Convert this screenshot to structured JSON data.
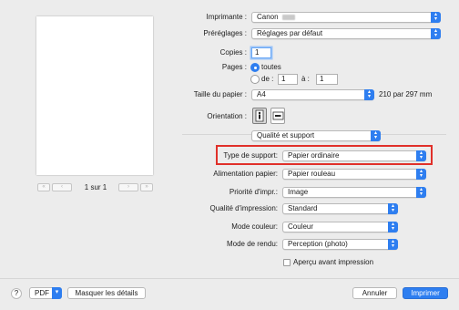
{
  "preview": {
    "page_indicator": "1 sur 1",
    "nav_first": "«",
    "nav_prev": "‹",
    "nav_next": "›",
    "nav_last": "»"
  },
  "form": {
    "printer_label": "Imprimante :",
    "printer_value": "Canon",
    "presets_label": "Préréglages :",
    "presets_value": "Réglages par défaut",
    "copies_label": "Copies :",
    "copies_value": "1",
    "pages_label": "Pages :",
    "pages_all": "toutes",
    "pages_from": "de :",
    "pages_from_value": "1",
    "pages_to": "à :",
    "pages_to_value": "1",
    "paper_size_label": "Taille du papier :",
    "paper_size_value": "A4",
    "paper_size_dims": "210 par 297 mm",
    "orientation_label": "Orientation :",
    "section_value": "Qualité et support",
    "media_type_label": "Type de support:",
    "media_type_value": "Papier ordinaire",
    "paper_source_label": "Alimentation papier:",
    "paper_source_value": "Papier rouleau",
    "print_priority_label": "Priorité d'impr.:",
    "print_priority_value": "Image",
    "print_quality_label": "Qualité d'impression:",
    "print_quality_value": "Standard",
    "color_mode_label": "Mode couleur:",
    "color_mode_value": "Couleur",
    "render_mode_label": "Mode de rendu:",
    "render_mode_value": "Perception (photo)",
    "preview_checkbox_label": "Aperçu avant impression"
  },
  "footer": {
    "help": "?",
    "pdf": "PDF",
    "hide_details": "Masquer les détails",
    "cancel": "Annuler",
    "print": "Imprimer"
  },
  "colors": {
    "accent": "#2e7ef0",
    "highlight_box": "#e0302a",
    "background": "#ececec"
  }
}
